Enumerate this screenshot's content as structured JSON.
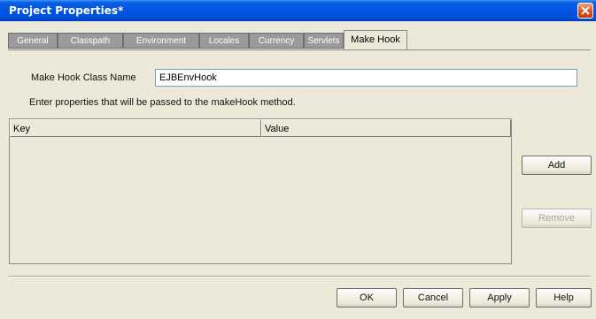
{
  "window": {
    "title": "Project Properties*"
  },
  "tabs": [
    {
      "label": "General",
      "active": false
    },
    {
      "label": "Classpath",
      "active": false
    },
    {
      "label": "Environment",
      "active": false
    },
    {
      "label": "Locales",
      "active": false
    },
    {
      "label": "Currency",
      "active": false
    },
    {
      "label": "Servlets",
      "active": false
    },
    {
      "label": "Make Hook",
      "active": true
    }
  ],
  "make_hook": {
    "class_name_label": "Make Hook Class Name",
    "class_name_value": "EJBEnvHook",
    "instructions": "Enter properties that will be passed to the makeHook method."
  },
  "table": {
    "columns": [
      "Key",
      "Value"
    ],
    "rows": []
  },
  "side_buttons": {
    "add": "Add",
    "remove": "Remove"
  },
  "footer_buttons": {
    "ok": "OK",
    "cancel": "Cancel",
    "apply": "Apply",
    "help": "Help"
  },
  "icons": {
    "close": "close-icon"
  },
  "colors": {
    "titlebar": "#0054e3",
    "close": "#d84b20"
  }
}
